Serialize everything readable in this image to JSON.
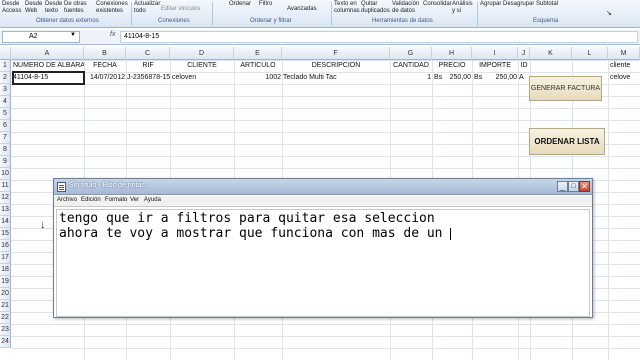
{
  "ribbon": {
    "buttons": [
      {
        "id": "desde-access",
        "label": "Desde\nAccess",
        "enabled": true
      },
      {
        "id": "desde-web",
        "label": "Desde\nWeb",
        "enabled": true
      },
      {
        "id": "desde-texto",
        "label": "Desde\ntexto",
        "enabled": true
      },
      {
        "id": "otras-fuentes",
        "label": "De otras\nfuentes",
        "enabled": true
      },
      {
        "id": "conexiones-existentes",
        "label": "Conexiones\nexistentes",
        "enabled": true
      },
      {
        "id": "actualizar-todo",
        "label": "Actualizar\ntodo",
        "enabled": true
      },
      {
        "id": "editar-vinculos",
        "label": "Editar vínculos",
        "enabled": false
      },
      {
        "id": "ordenar",
        "label": "Ordenar",
        "enabled": true
      },
      {
        "id": "filtro",
        "label": "Filtro",
        "enabled": true
      },
      {
        "id": "avanzadas",
        "label": "Avanzadas",
        "enabled": true
      },
      {
        "id": "texto-columnas",
        "label": "Texto en\ncolumnas",
        "enabled": true
      },
      {
        "id": "quitar-duplicados",
        "label": "Quitar\nduplicados",
        "enabled": true
      },
      {
        "id": "validacion-datos",
        "label": "Validación\nde datos",
        "enabled": true
      },
      {
        "id": "consolidar",
        "label": "Consolidar",
        "enabled": true
      },
      {
        "id": "analisis-si",
        "label": "Análisis\ny si",
        "enabled": true
      },
      {
        "id": "agrupar",
        "label": "Agrupar",
        "enabled": true
      },
      {
        "id": "desagrupar",
        "label": "Desagrupar",
        "enabled": true
      },
      {
        "id": "subtotal",
        "label": "Subtotal",
        "enabled": true
      }
    ],
    "groups": [
      "Obtener datos externos",
      "Conexiones",
      "Ordenar y filtrar",
      "Herramientas de datos",
      "Esquema"
    ]
  },
  "formula_bar": {
    "name_box": "A2",
    "fx": "fx",
    "value": "41104-8-15"
  },
  "columns": [
    "A",
    "B",
    "C",
    "D",
    "E",
    "F",
    "G",
    "H",
    "I",
    "J",
    "K",
    "L",
    "M"
  ],
  "rows": [
    "1",
    "2",
    "3",
    "4",
    "5",
    "6",
    "7",
    "8",
    "9",
    "10",
    "11",
    "12",
    "13",
    "14",
    "15",
    "16",
    "17",
    "18",
    "19",
    "20",
    "21",
    "22",
    "23",
    "24"
  ],
  "sheet": {
    "headers": [
      "NUMERO DE ALBARAN",
      "FECHA",
      "RIF",
      "CLIENTE",
      "ARTICULO",
      "DESCRIPCION",
      "CANTIDAD",
      "PRECIO",
      "IMPORTE",
      "ID",
      "cliente"
    ],
    "row2": {
      "albaran": "41104-8-15",
      "fecha": "14/07/2012",
      "rif": "J-2356878-15",
      "cliente": "celoven",
      "articulo": "1002",
      "descripcion": "Teclado Multi Tac",
      "cantidad": "1",
      "precio_cur": "Bs",
      "precio": "250,00",
      "importe_cur": "Bs",
      "importe": "250,00",
      "id": "A",
      "m": "celove"
    },
    "generar_factura": "GENERAR FACTURA",
    "ordenar_lista": "ORDENAR LISTA"
  },
  "notepad": {
    "title": "Sin título - Bloc de notas",
    "menu": [
      "Archivo",
      "Edición",
      "Formato",
      "Ver",
      "Ayuda"
    ],
    "lines": [
      "tengo que ir a filtros para quitar esa seleccion",
      "ahora te voy a mostrar que funciona con mas de un "
    ]
  }
}
